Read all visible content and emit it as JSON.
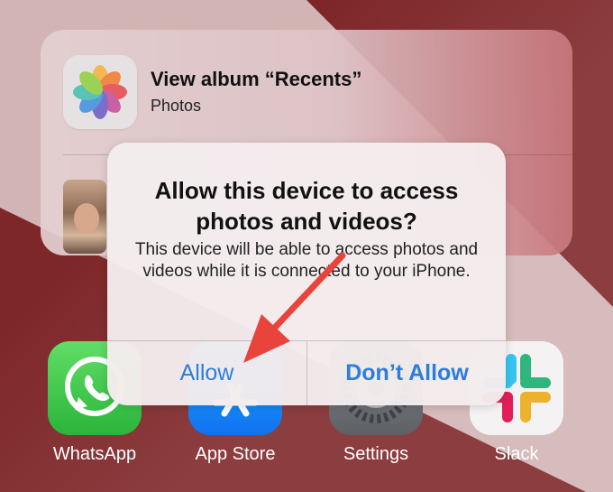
{
  "widget": {
    "title": "View album “Recents”",
    "subtitle": "Photos"
  },
  "alert": {
    "title": "Allow this device to access photos and videos?",
    "message": "This device will be able to access photos and videos while it is connected to your iPhone.",
    "allow_label": "Allow",
    "deny_label": "Don’t Allow",
    "button_color": "#2c7de0"
  },
  "dock": [
    {
      "label": "WhatsApp",
      "icon": "whatsapp-icon"
    },
    {
      "label": "App Store",
      "icon": "app-store-icon"
    },
    {
      "label": "Settings",
      "icon": "settings-icon"
    },
    {
      "label": "Slack",
      "icon": "slack-icon"
    }
  ],
  "annotation": {
    "arrow_color": "#e8443c",
    "points_to": "Allow"
  },
  "colors": {
    "wallpaper_dark": "#7e2729",
    "wallpaper_light": "#d2b4b4"
  }
}
